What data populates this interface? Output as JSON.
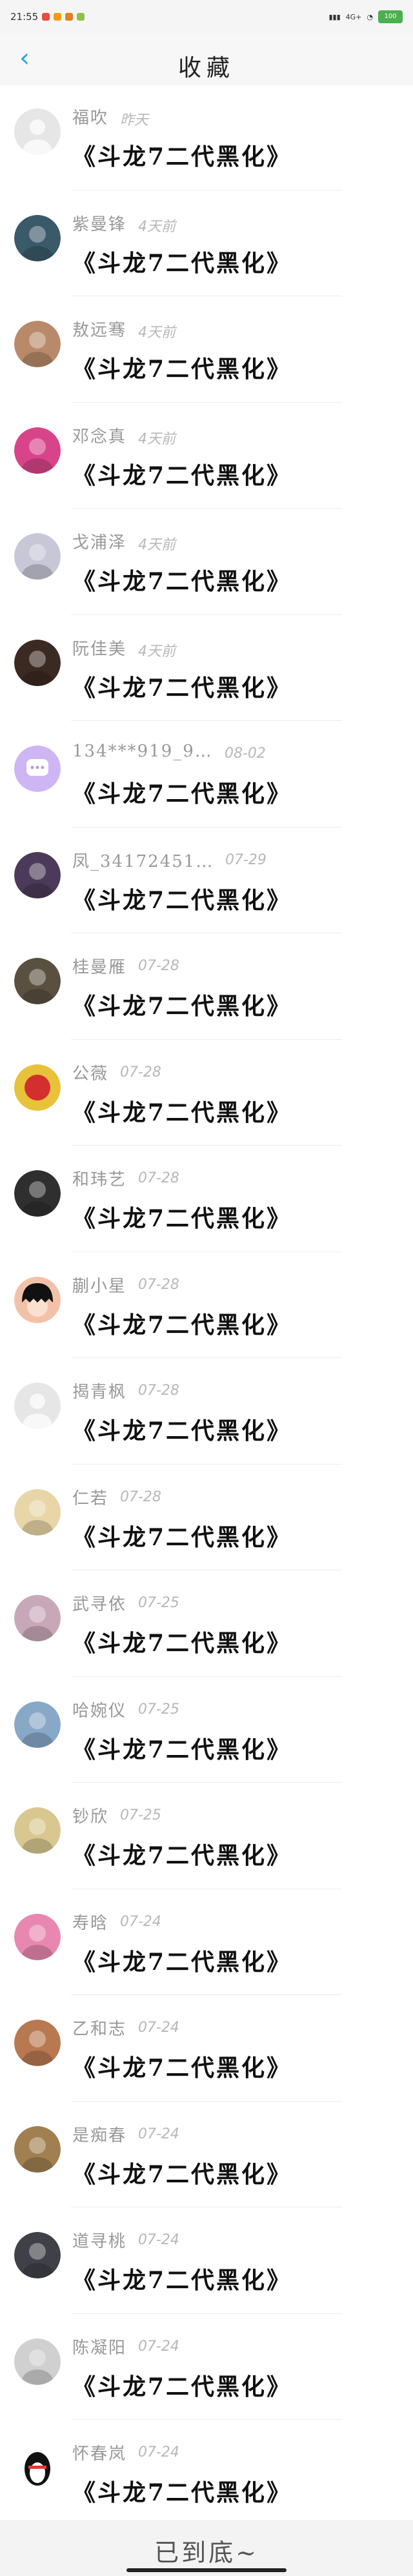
{
  "status": {
    "time": "21:55",
    "network": "4G+",
    "battery": "100"
  },
  "header": {
    "title": "收藏",
    "back_icon": "chevron-left-icon"
  },
  "items": [
    {
      "name": "福吹",
      "time": "昨天",
      "title": "《斗龙7二代黑化》",
      "avatar": "default"
    },
    {
      "name": "紫曼锋",
      "time": "4天前",
      "title": "《斗龙7二代黑化》",
      "avatar": "photo"
    },
    {
      "name": "敖远骞",
      "time": "4天前",
      "title": "《斗龙7二代黑化》",
      "avatar": "photo"
    },
    {
      "name": "邓念真",
      "time": "4天前",
      "title": "《斗龙7二代黑化》",
      "avatar": "photo"
    },
    {
      "name": "戈浦泽",
      "time": "4天前",
      "title": "《斗龙7二代黑化》",
      "avatar": "photo"
    },
    {
      "name": "阮佳美",
      "time": "4天前",
      "title": "《斗龙7二代黑化》",
      "avatar": "photo"
    },
    {
      "name": "134***919_9…",
      "time": "08-02",
      "title": "《斗龙7二代黑化》",
      "avatar": "chat"
    },
    {
      "name": "凤_34172451…",
      "time": "07-29",
      "title": "《斗龙7二代黑化》",
      "avatar": "photo"
    },
    {
      "name": "桂曼雁",
      "time": "07-28",
      "title": "《斗龙7二代黑化》",
      "avatar": "photo"
    },
    {
      "name": "公薇",
      "time": "07-28",
      "title": "《斗龙7二代黑化》",
      "avatar": "emblem"
    },
    {
      "name": "和玮艺",
      "time": "07-28",
      "title": "《斗龙7二代黑化》",
      "avatar": "photo"
    },
    {
      "name": "蒯小星",
      "time": "07-28",
      "title": "《斗龙7二代黑化》",
      "avatar": "cartoon"
    },
    {
      "name": "揭青枫",
      "time": "07-28",
      "title": "《斗龙7二代黑化》",
      "avatar": "default"
    },
    {
      "name": "仁若",
      "time": "07-28",
      "title": "《斗龙7二代黑化》",
      "avatar": "photo"
    },
    {
      "name": "武寻依",
      "time": "07-25",
      "title": "《斗龙7二代黑化》",
      "avatar": "photo"
    },
    {
      "name": "哈婉仪",
      "time": "07-25",
      "title": "《斗龙7二代黑化》",
      "avatar": "photo"
    },
    {
      "name": "钞欣",
      "time": "07-25",
      "title": "《斗龙7二代黑化》",
      "avatar": "photo"
    },
    {
      "name": "寿晗",
      "time": "07-24",
      "title": "《斗龙7二代黑化》",
      "avatar": "photo"
    },
    {
      "name": "乙和志",
      "time": "07-24",
      "title": "《斗龙7二代黑化》",
      "avatar": "photo"
    },
    {
      "name": "是痴春",
      "time": "07-24",
      "title": "《斗龙7二代黑化》",
      "avatar": "photo"
    },
    {
      "name": "道寻桃",
      "time": "07-24",
      "title": "《斗龙7二代黑化》",
      "avatar": "photo"
    },
    {
      "name": "陈凝阳",
      "time": "07-24",
      "title": "《斗龙7二代黑化》",
      "avatar": "photo"
    },
    {
      "name": "怀春岚",
      "time": "07-24",
      "title": "《斗龙7二代黑化》",
      "avatar": "penguin"
    }
  ],
  "avatar_colors": [
    "#e6e6e6",
    "#3a5a6a",
    "#b98a6a",
    "#d8448a",
    "#c7c7d7",
    "#3b2a22",
    "#cbb6f0",
    "#4c3a5a",
    "#5a5040",
    "#e8c23a",
    "#2f2f2f",
    "#f2c2a8",
    "#e6e6e6",
    "#e8d6a8",
    "#c8a8b8",
    "#88a8c8",
    "#d8c890",
    "#e888b0",
    "#b87850",
    "#a08050",
    "#404048",
    "#d0d0d0",
    "#111111"
  ],
  "footer": {
    "text": "已到底~"
  }
}
